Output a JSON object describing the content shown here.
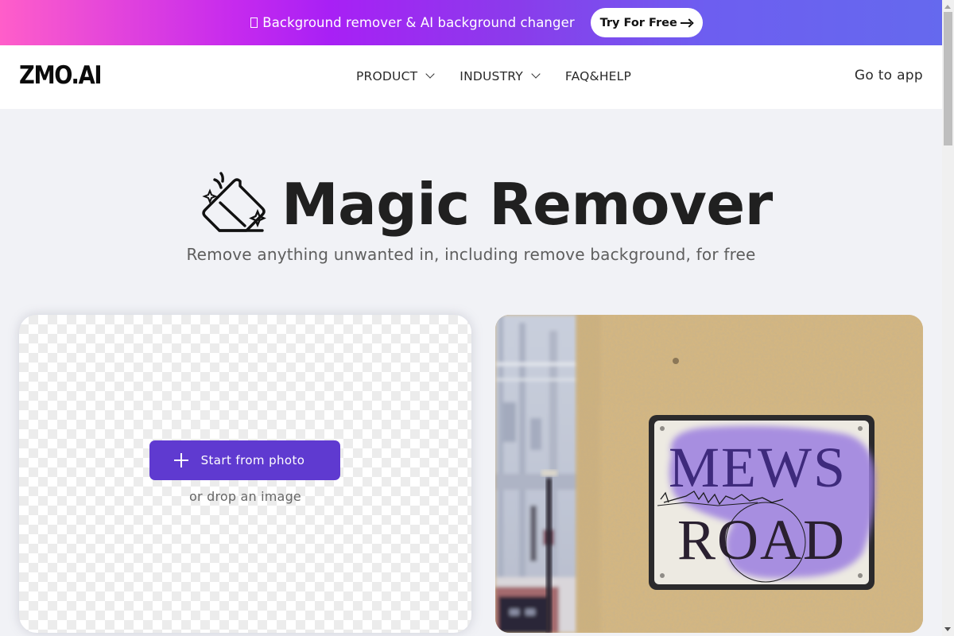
{
  "promo": {
    "text": "Background remover & AI background changer",
    "button_label": "Try For Free",
    "gradient": [
      "#ff5ec9",
      "#a820f5",
      "#6569ee"
    ]
  },
  "header": {
    "logo": "ZMO.AI",
    "nav": [
      {
        "label": "PRODUCT",
        "has_dropdown": true
      },
      {
        "label": "INDUSTRY",
        "has_dropdown": true
      },
      {
        "label": "FAQ&HELP",
        "has_dropdown": false
      }
    ],
    "cta": "Go to app"
  },
  "hero": {
    "icon": "eraser-icon",
    "title": "Magic Remover",
    "subtitle": "Remove anything unwanted in, including remove background, for free"
  },
  "upload": {
    "button_label": "Start from photo",
    "drop_hint": "or drop an image",
    "accent": "#5f3ad0"
  },
  "demo": {
    "sign_line1": "MEWS",
    "sign_line2": "ROAD",
    "mask_color": "#9b7fe0"
  }
}
